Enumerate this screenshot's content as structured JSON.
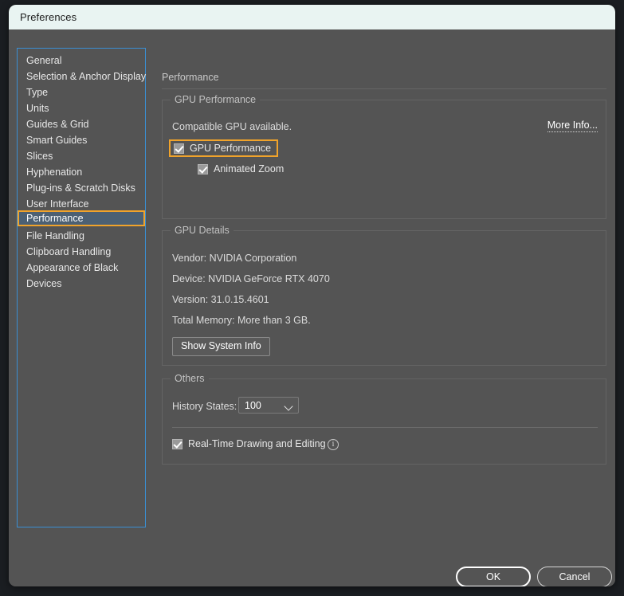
{
  "window": {
    "title": "Preferences"
  },
  "sidebar": {
    "items": [
      {
        "label": "General",
        "selected": false
      },
      {
        "label": "Selection & Anchor Display",
        "selected": false
      },
      {
        "label": "Type",
        "selected": false
      },
      {
        "label": "Units",
        "selected": false
      },
      {
        "label": "Guides & Grid",
        "selected": false
      },
      {
        "label": "Smart Guides",
        "selected": false
      },
      {
        "label": "Slices",
        "selected": false
      },
      {
        "label": "Hyphenation",
        "selected": false
      },
      {
        "label": "Plug-ins & Scratch Disks",
        "selected": false
      },
      {
        "label": "User Interface",
        "selected": false
      },
      {
        "label": "Performance",
        "selected": true
      },
      {
        "label": "File Handling",
        "selected": false
      },
      {
        "label": "Clipboard Handling",
        "selected": false
      },
      {
        "label": "Appearance of Black",
        "selected": false
      },
      {
        "label": "Devices",
        "selected": false
      }
    ]
  },
  "pane": {
    "title": "Performance",
    "gpu_performance": {
      "legend": "GPU Performance",
      "status_text": "Compatible GPU available.",
      "more_info_label": "More Info...",
      "gpu_performance_checkbox": {
        "label": "GPU Performance",
        "checked": true,
        "focused": true
      },
      "animated_zoom_checkbox": {
        "label": "Animated Zoom",
        "checked": true
      }
    },
    "gpu_details": {
      "legend": "GPU Details",
      "vendor": "Vendor: NVIDIA Corporation",
      "device": "Device: NVIDIA GeForce RTX 4070",
      "version": "Version: 31.0.15.4601",
      "total_memory": "Total Memory:  More than 3 GB.",
      "show_system_info_label": "Show System Info"
    },
    "others": {
      "legend": "Others",
      "history_states_label": "History States:",
      "history_states_value": "100",
      "history_states_options": [
        "100"
      ],
      "realtime_checkbox": {
        "label": "Real-Time Drawing and Editing",
        "checked": true
      },
      "info_icon_glyph": "i"
    }
  },
  "footer": {
    "ok_label": "OK",
    "cancel_label": "Cancel"
  },
  "colors": {
    "accent_focus": "#f0a32b",
    "selection": "#4c6073",
    "list_border": "#3a8fd4",
    "window_bg": "#545454",
    "titlebar_bg": "#e9f4f2"
  }
}
